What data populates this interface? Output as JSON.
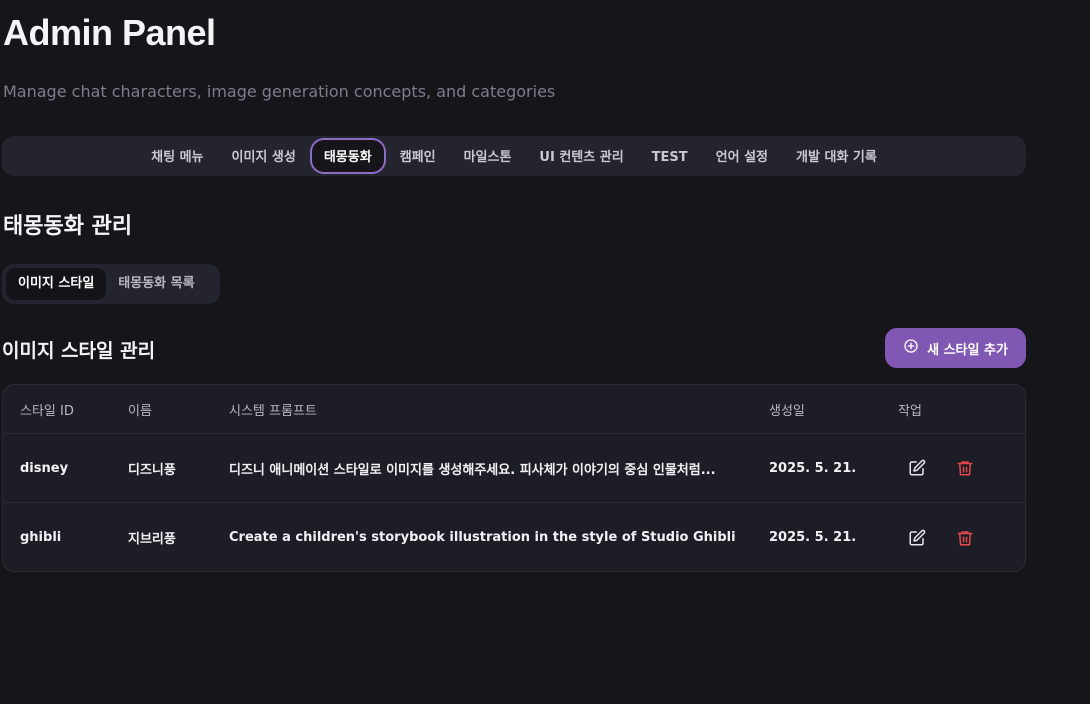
{
  "header": {
    "title": "Admin Panel",
    "subtitle": "Manage chat characters, image generation concepts, and categories"
  },
  "main_nav": {
    "tabs": [
      {
        "label": "채팅 메뉴"
      },
      {
        "label": "이미지 생성"
      },
      {
        "label": "태몽동화",
        "active": true
      },
      {
        "label": "캠페인"
      },
      {
        "label": "마일스톤"
      },
      {
        "label": "UI 컨텐츠 관리"
      },
      {
        "label": "TEST"
      },
      {
        "label": "언어 설정"
      },
      {
        "label": "개발 대화 기록"
      }
    ]
  },
  "section": {
    "title": "태몽동화 관리",
    "sub_tabs": [
      {
        "label": "이미지 스타일",
        "active": true
      },
      {
        "label": "태몽동화 목록"
      }
    ]
  },
  "panel": {
    "title": "이미지 스타일 관리",
    "add_button_label": "새 스타일 추가",
    "add_icon": "plus-circle-icon"
  },
  "table": {
    "columns": [
      "스타일 ID",
      "이름",
      "시스템 프롬프트",
      "생성일",
      "작업"
    ],
    "rows": [
      {
        "id": "disney",
        "name": "디즈니풍",
        "prompt": "디즈니 애니메이션 스타일로 이미지를 생성해주세요. 피사체가 이야기의 중심 인물처럼...",
        "created": "2025. 5. 21."
      },
      {
        "id": "ghibli",
        "name": "지브리풍",
        "prompt": "Create a children's storybook illustration in the style of Studio Ghibli animat...",
        "created": "2025. 5. 21."
      }
    ],
    "actions": {
      "edit_icon": "pencil-square-icon",
      "delete_icon": "trash-icon"
    }
  },
  "colors": {
    "background": "#15151a",
    "surface": "#24242e",
    "accent": "#8057b2",
    "active_border": "#8d6cc8",
    "delete": "#e5484d"
  }
}
